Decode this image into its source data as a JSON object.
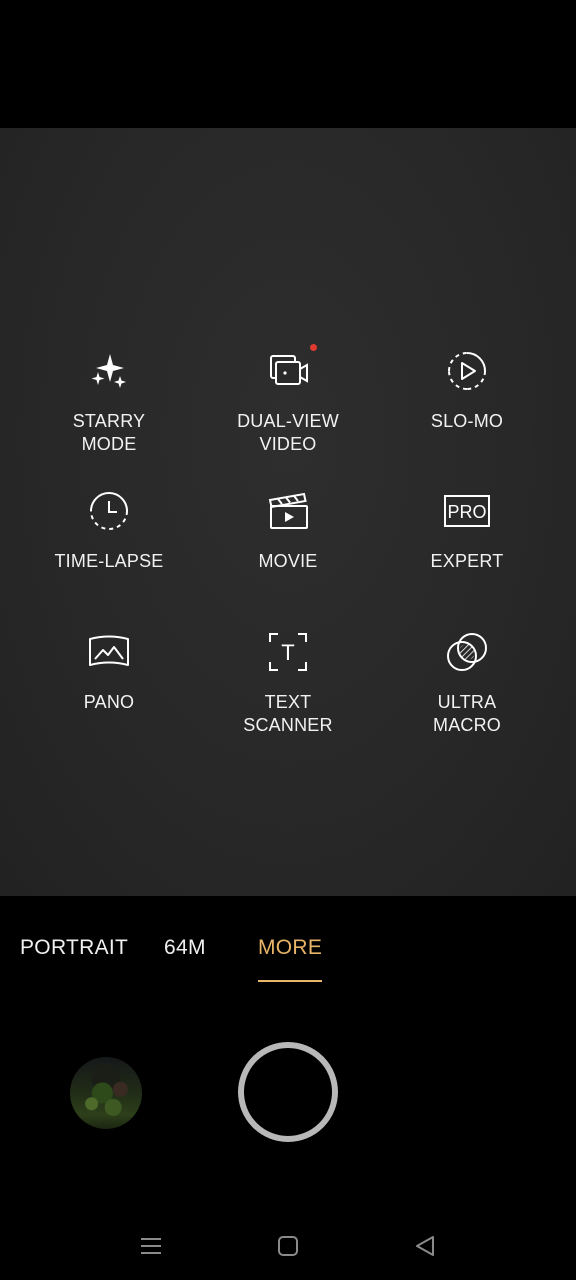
{
  "modes": [
    {
      "id": "starry-mode",
      "label": "STARRY\nMODE",
      "icon": "sparkles-icon"
    },
    {
      "id": "dual-view-video",
      "label": "DUAL-VIEW\nVIDEO",
      "icon": "dual-view-video-icon",
      "has_new_badge": true
    },
    {
      "id": "slo-mo",
      "label": "SLO-MO",
      "icon": "slow-motion-icon"
    },
    {
      "id": "time-lapse",
      "label": "TIME-LAPSE",
      "icon": "timer-icon"
    },
    {
      "id": "movie",
      "label": "MOVIE",
      "icon": "clapperboard-icon"
    },
    {
      "id": "expert",
      "label": "EXPERT",
      "icon": "pro-icon",
      "icon_text": "PRO"
    },
    {
      "id": "pano",
      "label": "PANO",
      "icon": "panorama-icon"
    },
    {
      "id": "text-scanner",
      "label": "TEXT\nSCANNER",
      "icon": "text-scan-icon",
      "icon_text": "T"
    },
    {
      "id": "ultra-macro",
      "label": "ULTRA\nMACRO",
      "icon": "macro-lens-icon"
    }
  ],
  "mode_strip": {
    "tabs": [
      {
        "label": "PORTRAIT",
        "active": false
      },
      {
        "label": "64M",
        "active": false
      },
      {
        "label": "MORE",
        "active": true
      }
    ]
  },
  "controls": {
    "gallery_icon": "gallery-thumbnail",
    "shutter_icon": "shutter-button"
  },
  "nav": {
    "icons": [
      "recent-apps-icon",
      "home-icon",
      "back-icon"
    ]
  },
  "colors": {
    "accent": "#e8b468",
    "badge": "#e03a30",
    "viewfinder": "#2a2a2a",
    "background": "#000000"
  }
}
